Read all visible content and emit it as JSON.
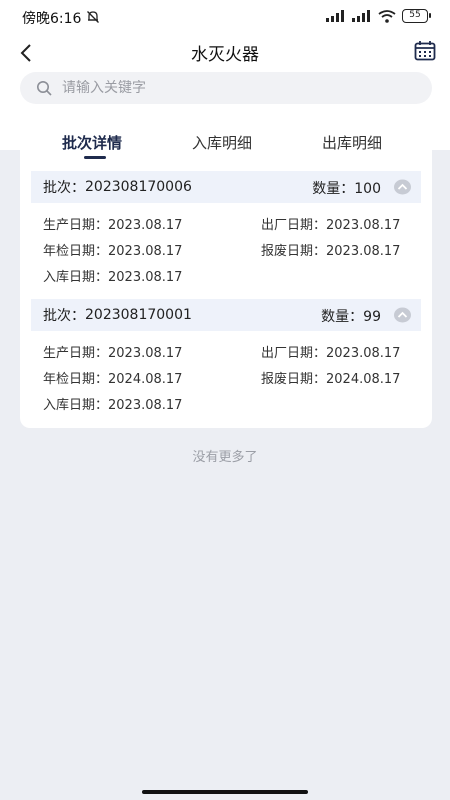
{
  "status_bar": {
    "time": "傍晚6:16",
    "battery": "55"
  },
  "header": {
    "title": "水灭火器"
  },
  "search": {
    "placeholder": "请输入关键字"
  },
  "tabs": [
    {
      "label": "批次详情",
      "active": true
    },
    {
      "label": "入库明细",
      "active": false
    },
    {
      "label": "出库明细",
      "active": false
    }
  ],
  "batches": [
    {
      "batch_label": "批次：",
      "batch_no": "202308170006",
      "qty_label": "数量：",
      "qty": "100",
      "production_label": "生产日期：",
      "production_date": "2023.08.17",
      "factory_label": "出厂日期：",
      "factory_date": "2023.08.17",
      "inspection_label": "年检日期：",
      "inspection_date": "2023.08.17",
      "scrap_label": "报废日期：",
      "scrap_date": "2023.08.17",
      "storage_label": "入库日期：",
      "storage_date": "2023.08.17"
    },
    {
      "batch_label": "批次：",
      "batch_no": "202308170001",
      "qty_label": "数量：",
      "qty": "99",
      "production_label": "生产日期：",
      "production_date": "2023.08.17",
      "factory_label": "出厂日期：",
      "factory_date": "2023.08.17",
      "inspection_label": "年检日期：",
      "inspection_date": "2024.08.17",
      "scrap_label": "报废日期：",
      "scrap_date": "2024.08.17",
      "storage_label": "入库日期：",
      "storage_date": "2023.08.17"
    }
  ],
  "footer": {
    "no_more": "没有更多了"
  },
  "colors": {
    "accent": "#1f2b4d",
    "batch_header_bg": "#eef2fa",
    "page_bg": "#eceef3"
  }
}
